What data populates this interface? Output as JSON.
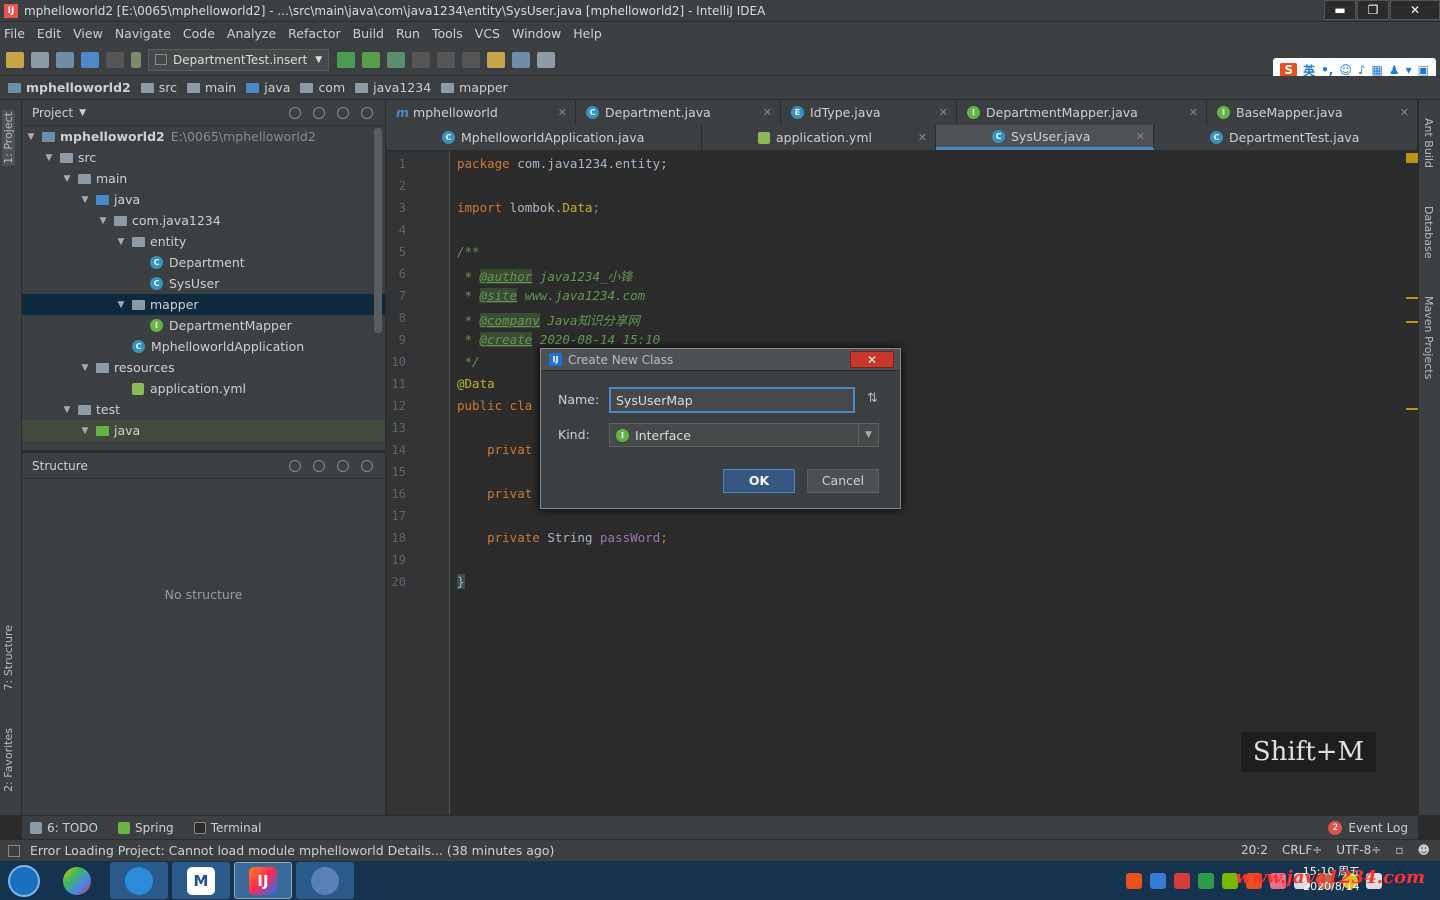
{
  "window": {
    "title": "mphelloworld2 [E:\\0065\\mphelloworld2] - ...\\src\\main\\java\\com\\java1234\\entity\\SysUser.java [mphelloworld2] - IntelliJ IDEA",
    "minimize": "▬",
    "maximize": "❐",
    "close": "✕"
  },
  "menu": [
    "File",
    "Edit",
    "View",
    "Navigate",
    "Code",
    "Analyze",
    "Refactor",
    "Build",
    "Run",
    "Tools",
    "VCS",
    "Window",
    "Help"
  ],
  "toolbar": {
    "run_config": "DepartmentTest.insert"
  },
  "ime": {
    "s": "S",
    "label": "英"
  },
  "breadcrumbs": [
    "mphelloworld2",
    "src",
    "main",
    "java",
    "com",
    "java1234",
    "mapper"
  ],
  "left_strip": {
    "project": "1: Project",
    "structure": "7: Structure",
    "favorites": "2: Favorites"
  },
  "right_strip": {
    "ant": "Ant Build",
    "database": "Database",
    "maven": "Maven Projects"
  },
  "project_panel": {
    "title": "Project",
    "tree": [
      {
        "label": "mphelloworld2",
        "path": "E:\\0065\\mphelloworld2"
      },
      {
        "label": "src"
      },
      {
        "label": "main"
      },
      {
        "label": "java"
      },
      {
        "label": "com.java1234"
      },
      {
        "label": "entity"
      },
      {
        "label": "Department"
      },
      {
        "label": "SysUser"
      },
      {
        "label": "mapper"
      },
      {
        "label": "DepartmentMapper"
      },
      {
        "label": "MphelloworldApplication"
      },
      {
        "label": "resources"
      },
      {
        "label": "application.yml"
      },
      {
        "label": "test"
      },
      {
        "label": "java"
      }
    ]
  },
  "structure_panel": {
    "title": "Structure",
    "empty": "No structure"
  },
  "tabs_row1": [
    {
      "label": "mphelloworld"
    },
    {
      "label": "Department.java"
    },
    {
      "label": "IdType.java"
    },
    {
      "label": "DepartmentMapper.java"
    },
    {
      "label": "BaseMapper.java"
    }
  ],
  "tabs_row2": [
    {
      "label": "MphelloworldApplication.java"
    },
    {
      "label": "application.yml"
    },
    {
      "label": "SysUser.java"
    },
    {
      "label": "DepartmentTest.java"
    }
  ],
  "code": {
    "line_numbers": [
      "1",
      "2",
      "3",
      "4",
      "5",
      "6",
      "7",
      "8",
      "9",
      "10",
      "11",
      "12",
      "13",
      "14",
      "15",
      "16",
      "17",
      "18",
      "19",
      "20"
    ],
    "l1_kw": "package",
    "l1_rest": " com.java1234.entity;",
    "l3_kw": "import",
    "l3_rest": " lombok.",
    "l3_cls": "Data",
    "l3_end": ";",
    "l5": "/**",
    "l6_star": " * ",
    "l6_tag": "@author",
    "l6_val": " java1234_小锋",
    "l7_star": " * ",
    "l7_tag": "@site",
    "l7_val": " www.java1234.com",
    "l8_star": " * ",
    "l8_tag": "@company",
    "l8_val": " Java知识分享网",
    "l9_star": " * ",
    "l9_tag": "@create",
    "l9_val": " 2020-08-14 15:10",
    "l10": " */",
    "l11": "@Data",
    "l12_kw": "public cla",
    "l14_kw": "    privat",
    "l16_kw": "    privat",
    "l18_kw": "    private",
    "l18_type": " String ",
    "l18_field": "passWord",
    "l18_end": ";",
    "l20": "}"
  },
  "hint": "Shift+M",
  "dialog": {
    "title": "Create New Class",
    "close": "✕",
    "name_label": "Name:",
    "name_value": "SysUserMap",
    "kind_label": "Kind:",
    "kind_value": "Interface",
    "ok": "OK",
    "cancel": "Cancel"
  },
  "bottom_tools": {
    "todo": "6: TODO",
    "spring": "Spring",
    "terminal": "Terminal",
    "event_log": "Event Log",
    "event_count": "2"
  },
  "status": {
    "message": "Error Loading Project: Cannot load module mphelloworld Details... (38 minutes ago)",
    "position": "20:2",
    "line_sep": "CRLF÷",
    "encoding": "UTF-8÷"
  },
  "taskbar": {
    "clock_time": "15:10 周五",
    "clock_date": "2020/8/14",
    "watermark": "www.java1234.com"
  }
}
